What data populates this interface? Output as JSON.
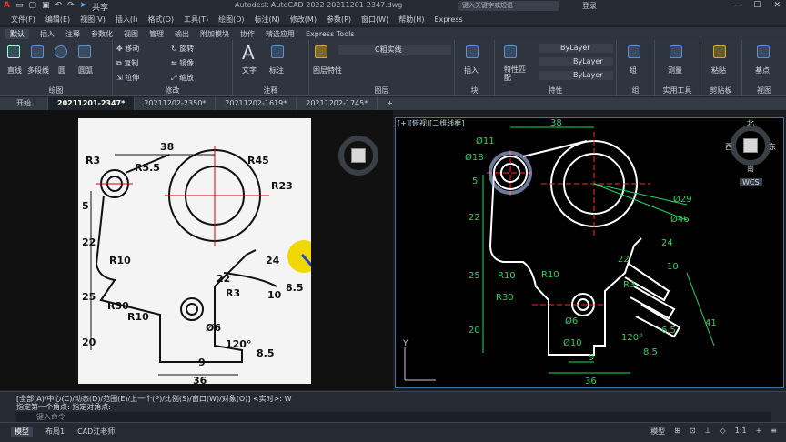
{
  "titlebar": {
    "app_title": "Autodesk AutoCAD 2022  20211201-2347.dwg",
    "search_placeholder": "键入关键字或短语",
    "login": "登录",
    "share": "共享"
  },
  "menubar": [
    "文件(F)",
    "编辑(E)",
    "视图(V)",
    "插入(I)",
    "格式(O)",
    "工具(T)",
    "绘图(D)",
    "标注(N)",
    "修改(M)",
    "参数(P)",
    "窗口(W)",
    "帮助(H)",
    "Express"
  ],
  "ribbon_tabs": [
    "默认",
    "插入",
    "注释",
    "参数化",
    "视图",
    "管理",
    "输出",
    "附加模块",
    "协作",
    "精选应用",
    "Express Tools"
  ],
  "ribbon": {
    "draw": {
      "label": "绘图",
      "items": [
        "直线",
        "多段线",
        "圆",
        "圆弧"
      ]
    },
    "modify": {
      "label": "修改",
      "items": [
        "移动",
        "旋转",
        "复制",
        "镜像",
        "拉伸",
        "缩放"
      ]
    },
    "annotation": {
      "label": "注释",
      "items": [
        "文字",
        "标注"
      ]
    },
    "layers": {
      "label": "图层",
      "items": [
        "图层特性"
      ],
      "current_layer": "C粗实线"
    },
    "block": {
      "label": "块",
      "items": [
        "插入"
      ]
    },
    "properties": {
      "label": "特性",
      "items": [
        "特性匹配"
      ],
      "bylayer": [
        "ByLayer",
        "ByLayer",
        "ByLayer"
      ]
    },
    "groups": {
      "label": "组",
      "items": [
        "组"
      ]
    },
    "utilities": {
      "label": "实用工具",
      "items": [
        "测量"
      ]
    },
    "clipboard": {
      "label": "剪贴板",
      "items": [
        "粘贴"
      ]
    },
    "view": {
      "label": "视图",
      "items": [
        "基点"
      ]
    }
  },
  "doc_tabs": [
    "开始",
    "20211201-2347*",
    "20211202-2350*",
    "20211202-1619*",
    "20211202-1745*"
  ],
  "viewport_label": "[+][俯视][二维线框]",
  "compass": {
    "north": "北",
    "south": "南",
    "east": "东",
    "west": "西",
    "wcs": "WCS"
  },
  "drawing_dims": [
    "38",
    "Ø11",
    "Ø18",
    "R45",
    "R23",
    "5",
    "22",
    "25",
    "30",
    "20",
    "R10",
    "R30",
    "R10",
    "Ø29",
    "Ø46",
    "24",
    "10",
    "22",
    "R3",
    "9",
    "36",
    "Ø10",
    "Ø6",
    "8.5",
    "6.5",
    "120°",
    "41"
  ],
  "photo_dims": [
    "38",
    "R3",
    "R5.5",
    "R45",
    "R23",
    "5",
    "22",
    "25",
    "30",
    "20",
    "R10",
    "R30",
    "R10",
    "24",
    "22",
    "10",
    "R3",
    "9",
    "36",
    "8.5",
    "8.5",
    "120°",
    "Ø6"
  ],
  "command": {
    "line1": "[全部(A)/中心(C)/动态(D)/范围(E)/上一个(P)/比例(S)/窗口(W)/对象(O)] <实时>: W",
    "line2": "指定第一个角点: 指定对角点:",
    "placeholder": "键入命令"
  },
  "status": {
    "tabs": [
      "模型",
      "布局1",
      "CAD江老师"
    ],
    "right": [
      "模型",
      "1:1",
      "+"
    ]
  }
}
